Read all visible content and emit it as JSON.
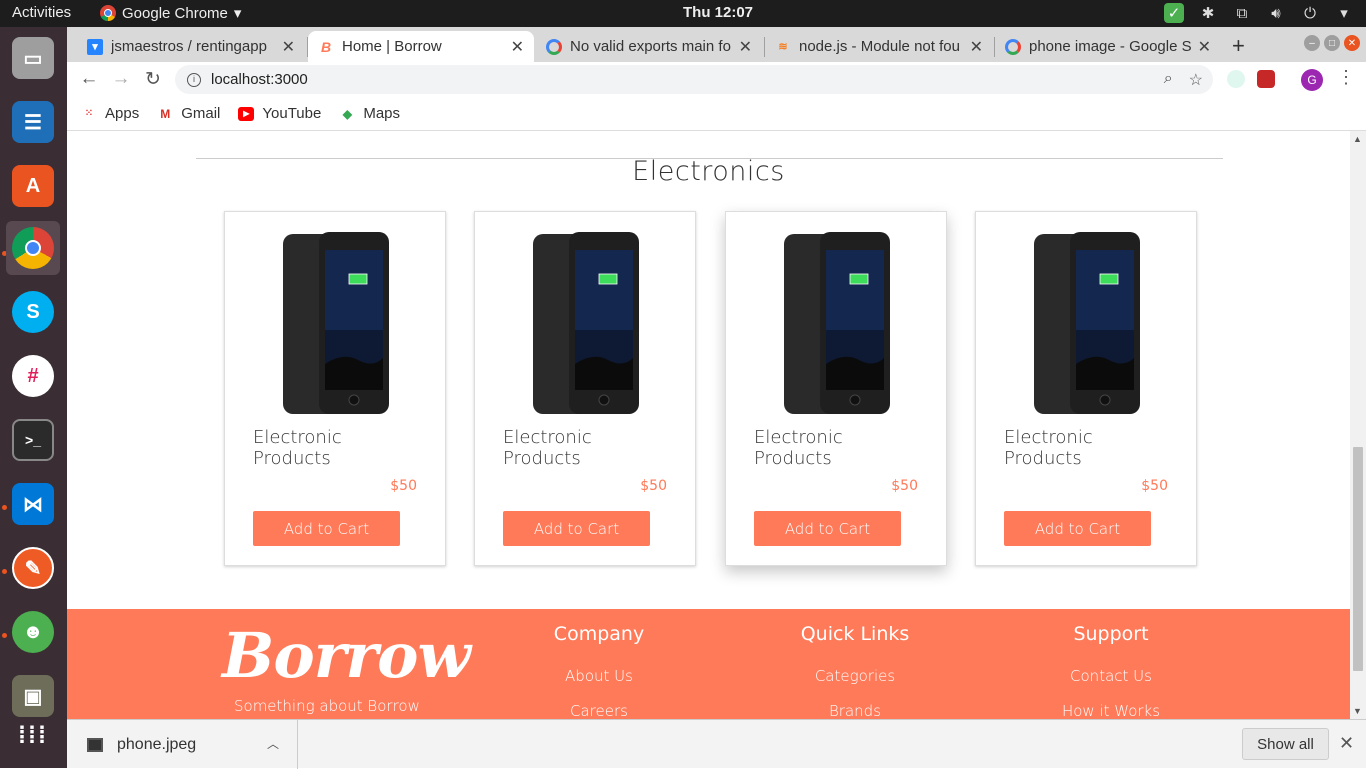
{
  "os": {
    "activities": "Activities",
    "app_name": "Google Chrome",
    "clock": "Thu 12:07"
  },
  "browser": {
    "tabs": [
      {
        "label": "jsmaestros / rentingapp",
        "favicon": "bitbucket-icon"
      },
      {
        "label": "Home | Borrow",
        "favicon": "borrow-icon"
      },
      {
        "label": "No valid exports main fo",
        "favicon": "google-icon"
      },
      {
        "label": "node.js - Module not fou",
        "favicon": "stackoverflow-icon"
      },
      {
        "label": "phone image - Google Se",
        "favicon": "google-icon"
      }
    ],
    "active_tab": 1,
    "url": "localhost:3000",
    "avatar_letter": "G",
    "bookmarks": [
      {
        "label": "Apps"
      },
      {
        "label": "Gmail"
      },
      {
        "label": "YouTube"
      },
      {
        "label": "Maps"
      }
    ]
  },
  "page": {
    "section_title": "Electronics",
    "products": [
      {
        "name": "Electronic Products",
        "price": "$50",
        "button": "Add to Cart"
      },
      {
        "name": "Electronic Products",
        "price": "$50",
        "button": "Add to Cart"
      },
      {
        "name": "Electronic Products",
        "price": "$50",
        "button": "Add to Cart"
      },
      {
        "name": "Electronic Products",
        "price": "$50",
        "button": "Add to Cart"
      }
    ],
    "footer": {
      "logo": "Borrow",
      "tagline": "Something about Borrow",
      "columns": [
        {
          "title": "Company",
          "links": [
            "About Us",
            "Careers"
          ]
        },
        {
          "title": "Quick Links",
          "links": [
            "Categories",
            "Brands"
          ]
        },
        {
          "title": "Support",
          "links": [
            "Contact Us",
            "How it Works"
          ]
        }
      ]
    }
  },
  "downloads": {
    "file": "phone.jpeg",
    "show_all": "Show all"
  },
  "colors": {
    "accent": "#ff7a59",
    "ubuntu_orange": "#e95420"
  }
}
